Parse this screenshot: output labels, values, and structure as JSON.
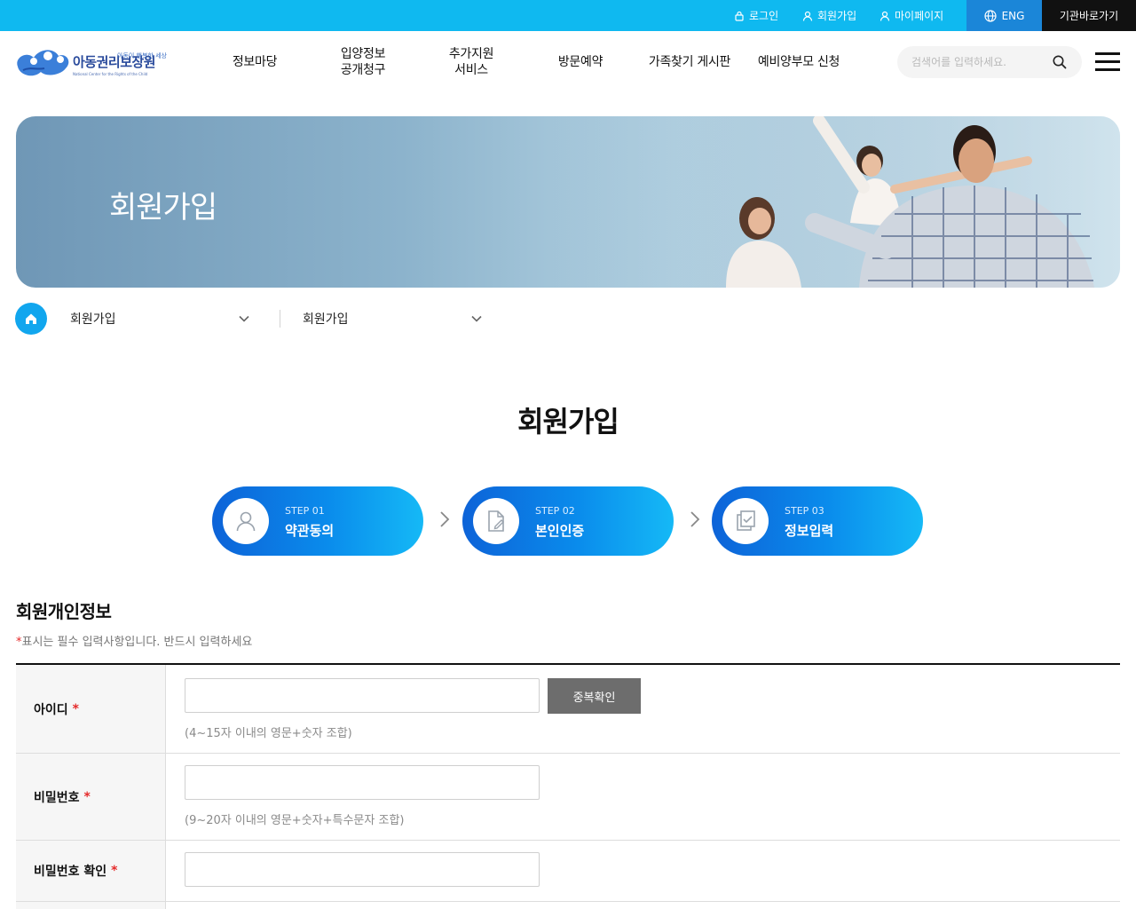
{
  "topbar": {
    "login": "로그인",
    "signup": "회원가입",
    "mypage": "마이페이지",
    "eng": "ENG",
    "shortcut": "기관바로가기"
  },
  "header": {
    "logo_slogan": "아동이 행복한 세상",
    "logo_name": "아동권리보장원",
    "logo_en": "National Center for the Rights of the Child",
    "nav": [
      {
        "line1": "정보마당",
        "line2": ""
      },
      {
        "line1": "입양정보",
        "line2": "공개청구"
      },
      {
        "line1": "추가지원",
        "line2": "서비스"
      },
      {
        "line1": "방문예약",
        "line2": ""
      },
      {
        "line1": "가족찾기 게시판",
        "line2": ""
      },
      {
        "line1": "예비양부모 신청",
        "line2": ""
      }
    ],
    "search_placeholder": "검색어를 입력하세요."
  },
  "banner": {
    "title": "회원가입"
  },
  "breadcrumb": {
    "level1": "회원가입",
    "level2": "회원가입"
  },
  "page_title": "회원가입",
  "steps": [
    {
      "num": "STEP 01",
      "label": "약관동의"
    },
    {
      "num": "STEP 02",
      "label": "본인인증"
    },
    {
      "num": "STEP 03",
      "label": "정보입력"
    }
  ],
  "section": {
    "title": "회원개인정보",
    "required_star": "*",
    "required_note": "표시는 필수 입력사항입니다. 반드시 입력하세요"
  },
  "form": {
    "id_label": "아이디",
    "id_hint": "(4~15자 이내의 영문+숫자 조합)",
    "dup_button": "중복확인",
    "pw_label": "비밀번호",
    "pw_hint": "(9~20자 이내의 영문+숫자+특수문자 조합)",
    "pw_confirm_label": "비밀번호 확인",
    "star": "*"
  },
  "colors": {
    "topbar": "#0fb9f0",
    "eng_bg": "#1b86d8",
    "shortcut_bg": "#111111",
    "accent": "#11a6ee",
    "required": "#e52a2a"
  }
}
